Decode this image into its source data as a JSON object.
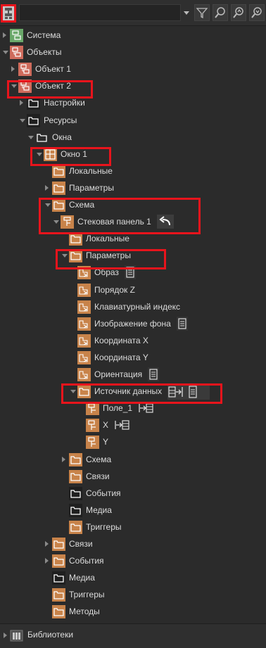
{
  "toolbar": {
    "search_value": "",
    "icons": [
      "tree-root-icon",
      "dropdown-icon",
      "filter-icon",
      "search-icon",
      "search-up-icon",
      "search-down-icon"
    ]
  },
  "tree": {
    "rows": [
      {
        "label": "Система",
        "level": 0,
        "arrow": "right",
        "icon": "system"
      },
      {
        "label": "Объекты",
        "level": 0,
        "arrow": "down",
        "icon": "objects"
      },
      {
        "label": "Объект 1",
        "level": 1,
        "arrow": "right",
        "icon": "objects"
      },
      {
        "label": "Объект 2",
        "level": 1,
        "arrow": "down",
        "icon": "objects"
      },
      {
        "label": "Настройки",
        "level": 2,
        "arrow": "right",
        "icon": "folder-white"
      },
      {
        "label": "Ресурсы",
        "level": 2,
        "arrow": "down",
        "icon": "folder-white"
      },
      {
        "label": "Окна",
        "level": 3,
        "arrow": "down",
        "icon": "folder-white-plain"
      },
      {
        "label": "Окно 1",
        "level": 4,
        "arrow": "down",
        "icon": "window"
      },
      {
        "label": "Локальные",
        "level": 5,
        "arrow": "none",
        "icon": "folder-orange"
      },
      {
        "label": "Параметры",
        "level": 5,
        "arrow": "right",
        "icon": "folder-orange"
      },
      {
        "label": "Схема",
        "level": 5,
        "arrow": "down",
        "icon": "folder-orange"
      },
      {
        "label": "Стековая панель 1",
        "level": 6,
        "arrow": "down",
        "icon": "stackpanel",
        "extra": "undo"
      },
      {
        "label": "Локальные",
        "level": 7,
        "arrow": "none",
        "icon": "folder-orange"
      },
      {
        "label": "Параметры",
        "level": 7,
        "arrow": "down",
        "icon": "folder-orange"
      },
      {
        "label": "Образ",
        "level": 8,
        "arrow": "none",
        "icon": "param",
        "extra": "list"
      },
      {
        "label": "Порядок Z",
        "level": 8,
        "arrow": "none",
        "icon": "param"
      },
      {
        "label": "Клавиатурный индекс",
        "level": 8,
        "arrow": "none",
        "icon": "param"
      },
      {
        "label": "Изображение фона",
        "level": 8,
        "arrow": "none",
        "icon": "param",
        "extra": "list"
      },
      {
        "label": "Координата X",
        "level": 8,
        "arrow": "none",
        "icon": "param"
      },
      {
        "label": "Координата Y",
        "level": 8,
        "arrow": "none",
        "icon": "param"
      },
      {
        "label": "Ориентация",
        "level": 8,
        "arrow": "none",
        "icon": "param",
        "extra": "list"
      },
      {
        "label": "Источник данных",
        "level": 8,
        "arrow": "down",
        "icon": "folder-orange",
        "extra": "datasource"
      },
      {
        "label": "Поле_1",
        "level": 9,
        "arrow": "none",
        "icon": "field",
        "extra": "link"
      },
      {
        "label": "X",
        "level": 9,
        "arrow": "none",
        "icon": "field",
        "extra": "link"
      },
      {
        "label": "Y",
        "level": 9,
        "arrow": "none",
        "icon": "field"
      },
      {
        "label": "Схема",
        "level": 7,
        "arrow": "right",
        "icon": "folder-orange"
      },
      {
        "label": "Связи",
        "level": 7,
        "arrow": "none",
        "icon": "folder-orange"
      },
      {
        "label": "События",
        "level": 7,
        "arrow": "none",
        "icon": "folder-white"
      },
      {
        "label": "Медиа",
        "level": 7,
        "arrow": "none",
        "icon": "folder-white"
      },
      {
        "label": "Триггеры",
        "level": 7,
        "arrow": "none",
        "icon": "folder-orange"
      },
      {
        "label": "Связи",
        "level": 5,
        "arrow": "right",
        "icon": "folder-orange"
      },
      {
        "label": "События",
        "level": 5,
        "arrow": "right",
        "icon": "folder-orange"
      },
      {
        "label": "Медиа",
        "level": 5,
        "arrow": "none",
        "icon": "folder-white"
      },
      {
        "label": "Триггеры",
        "level": 5,
        "arrow": "none",
        "icon": "folder-orange"
      },
      {
        "label": "Методы",
        "level": 5,
        "arrow": "none",
        "icon": "folder-orange"
      }
    ]
  },
  "bottom": {
    "label": "Библиотеки",
    "icon": "library"
  },
  "colors": {
    "highlight": "#e8141c",
    "orange": "#c8834a",
    "salmon": "#cf6b5c",
    "green": "#6aa86a"
  }
}
